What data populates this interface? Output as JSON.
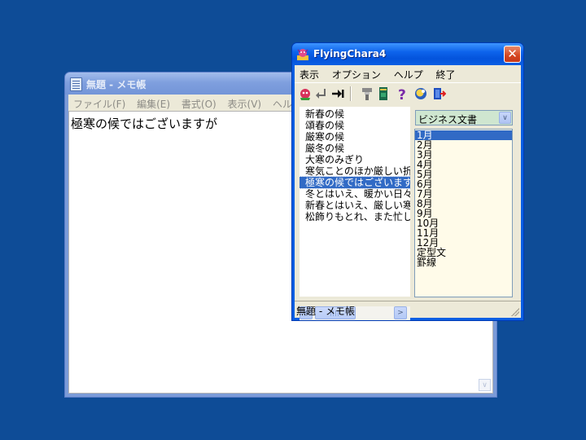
{
  "notepad": {
    "title": "無題 - メモ帳",
    "menu": [
      "ファイル(F)",
      "編集(E)",
      "書式(O)",
      "表示(V)",
      "ヘルプ(H)"
    ],
    "content": "極寒の候ではございますが",
    "scroll_down_glyph": "∨"
  },
  "flyingchara": {
    "title": "FlyingChara4",
    "close_glyph": "✕",
    "menu": [
      "表示",
      "オプション",
      "ヘルプ",
      "終了"
    ],
    "toolbar_icons": [
      "chara-icon",
      "return-icon",
      "tab-icon",
      "stamp-icon",
      "book-icon",
      "help-icon",
      "balloon-icon",
      "exit-icon"
    ],
    "phrases": [
      "新春の候",
      "頌春の候",
      "厳寒の候",
      "厳冬の候",
      "大寒のみぎり",
      "寒気ことのほか厳しい折",
      "極寒の候ではございますが",
      "冬とはいえ、暖かい日々",
      "新春とはいえ、厳しい寒",
      "松飾りもとれ、また忙しい"
    ],
    "selected_phrase_index": 6,
    "category": "ビジネス文書",
    "dropdown_glyph": "∨",
    "months": [
      "1月",
      "2月",
      "3月",
      "4月",
      "5月",
      "6月",
      "7月",
      "8月",
      "9月",
      "10月",
      "11月",
      "12月",
      "定型文",
      "罫線"
    ],
    "selected_month_index": 0,
    "scroll_left_glyph": "<",
    "scroll_right_glyph": ">",
    "status": "無題 - メモ帳"
  },
  "colors": {
    "desktop": "#0e4c97",
    "selection": "#316ac5",
    "active_title": "#0a5fe3",
    "inactive_title": "#7b9bd8"
  }
}
